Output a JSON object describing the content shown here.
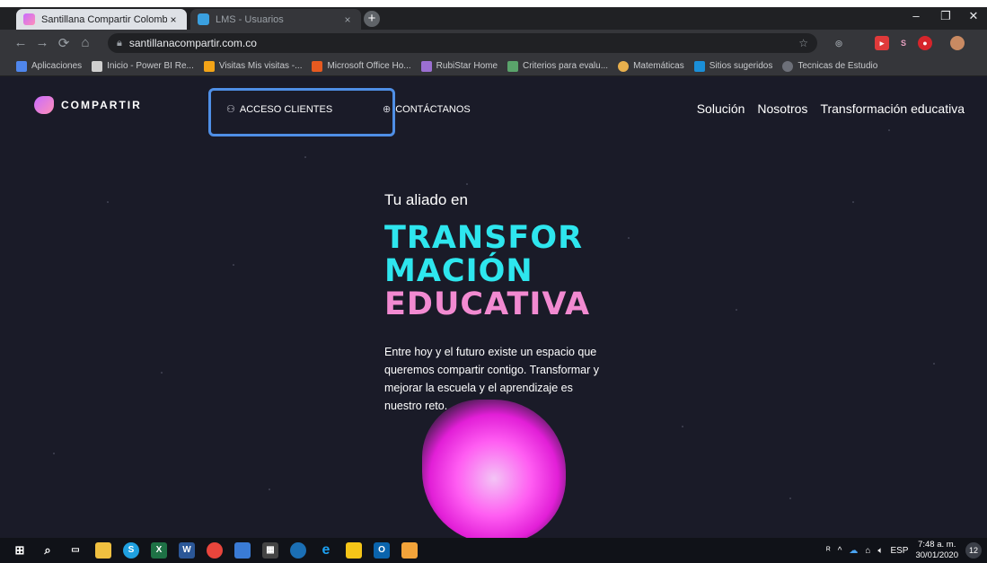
{
  "browser": {
    "tabs": [
      {
        "title": "Santillana Compartir Colombia",
        "close": "×"
      },
      {
        "title": "LMS - Usuarios",
        "close": "×"
      }
    ],
    "new_tab": "+",
    "window_controls": {
      "minimize": "–",
      "restore": "❐",
      "close": "✕"
    },
    "url": "santillanacompartir.com.co",
    "bookmarks": [
      "Aplicaciones",
      "Inicio - Power BI Re...",
      "Visitas Mis visitas -...",
      "Microsoft Office Ho...",
      "RubiStar Home",
      "Criterios para evalu...",
      "Matemáticas",
      "Sitios sugeridos",
      "Tecnicas de Estudio"
    ],
    "extensions": [
      "S"
    ]
  },
  "site": {
    "logo_text": "COMPARTIR",
    "nav_left": [
      {
        "label": "ACCESO CLIENTES",
        "icon": "user-icon"
      },
      {
        "label": "CONTÁCTANOS",
        "icon": "globe-icon"
      }
    ],
    "nav_right": [
      "Solución",
      "Nosotros",
      "Transformación educativa"
    ],
    "hero": {
      "pretitle": "Tu aliado en",
      "title_line1": "TRANSFOR",
      "title_line2": "MACIÓN",
      "title_line3": "EDUCATIVA",
      "body": "Entre hoy y el futuro existe un espacio que queremos compartir contigo. Transformar y mejorar la escuela y el aprendizaje es nuestro reto."
    },
    "colors": {
      "background": "#1a1b28",
      "accent_cyan": "#2ee6ee",
      "accent_pink": "#f28ad1",
      "highlight_box": "#4f8fe6"
    }
  },
  "taskbar": {
    "language": "ESP",
    "time": "7:48 a. m.",
    "date": "30/01/2020",
    "notifications": "12"
  }
}
